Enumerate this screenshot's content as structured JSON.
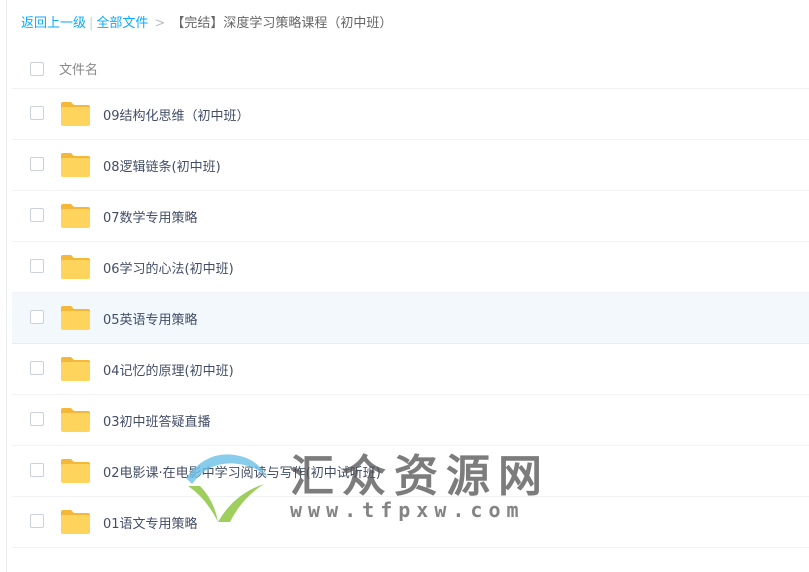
{
  "breadcrumb": {
    "back": "返回上一级",
    "divider": "|",
    "all_files": "全部文件",
    "arrow": ">",
    "current": "【完结】深度学习策略课程（初中班）"
  },
  "list_header": {
    "column": "文件名"
  },
  "rows": [
    {
      "name": "09结构化思维（初中班）"
    },
    {
      "name": "08逻辑链条(初中班)"
    },
    {
      "name": "07数学专用策略"
    },
    {
      "name": "06学习的心法(初中班)"
    },
    {
      "name": "05英语专用策略"
    },
    {
      "name": "04记忆的原理(初中班)"
    },
    {
      "name": "03初中班答疑直播"
    },
    {
      "name": "02电影课·在电影中学习阅读与写作(初中试听班)"
    },
    {
      "name": "01语文专用策略"
    }
  ],
  "icons": {
    "folder": "folder-icon",
    "checkbox": "checkbox"
  },
  "colors": {
    "link": "#09aaff",
    "folder": "#ffd45c",
    "selected_row": "#f3f8fd"
  },
  "watermark": {
    "title": "汇众资源网",
    "url": "www.tfpxw.com"
  }
}
